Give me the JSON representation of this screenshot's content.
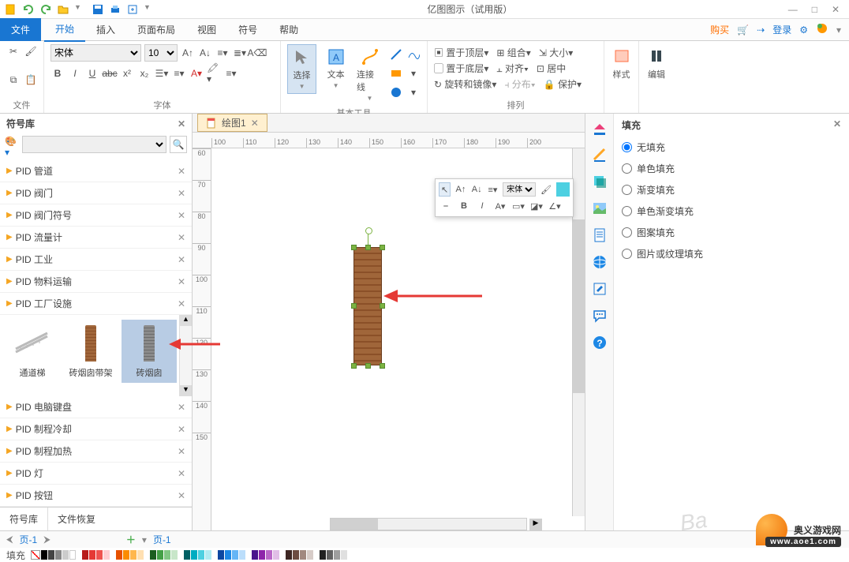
{
  "app": {
    "title": "亿图图示（试用版）"
  },
  "window_controls": {
    "min": "—",
    "max": "□",
    "close": "✕"
  },
  "menu": {
    "file": "文件",
    "items": [
      "开始",
      "插入",
      "页面布局",
      "视图",
      "符号",
      "帮助"
    ],
    "right": {
      "buy": "购买",
      "login": "登录"
    }
  },
  "ribbon": {
    "group_file": "文件",
    "group_font": "字体",
    "group_tools": "基本工具",
    "group_arrange": "排列",
    "group_style": "样式",
    "group_edit": "编辑",
    "font_name": "宋体",
    "font_size": "10",
    "bold": "B",
    "italic": "I",
    "underline": "U",
    "strike": "abc",
    "sup": "x²",
    "sub": "x₂",
    "tool_select": "选择",
    "tool_text": "文本",
    "tool_connector": "连接线",
    "arr_front": "置于顶层",
    "arr_back": "置于底层",
    "arr_rotate": "旋转和镜像",
    "arr_group": "组合",
    "arr_align": "对齐",
    "arr_distribute": "分布",
    "arr_size": "大小",
    "arr_center": "居中",
    "arr_protect": "保护",
    "style": "样式",
    "edit": "编辑"
  },
  "sidebar": {
    "title": "符号库",
    "search_placeholder": "",
    "categories": [
      "PID 管道",
      "PID 阀门",
      "PID 阀门符号",
      "PID 流量计",
      "PID 工业",
      "PID 物料运输",
      "PID 工厂设施"
    ],
    "categories_after": [
      "PID 电脑键盘",
      "PID 制程冷却",
      "PID 制程加热",
      "PID 灯",
      "PID 按钮"
    ],
    "shapes": [
      "通道梯",
      "砖烟囱带架",
      "砖烟囱"
    ],
    "footer": {
      "lib": "符号库",
      "recover": "文件恢复"
    }
  },
  "tabs": {
    "main": "绘图1"
  },
  "ruler_h": [
    "100",
    "110",
    "120",
    "130",
    "140",
    "150",
    "160",
    "170",
    "180",
    "190",
    "200"
  ],
  "ruler_v": [
    "60",
    "70",
    "80",
    "90",
    "100",
    "110",
    "120",
    "130",
    "140",
    "150"
  ],
  "float_tb": {
    "font_opt": "宋体"
  },
  "fill_panel": {
    "title": "填充",
    "options": [
      "无填充",
      "单色填充",
      "渐变填充",
      "单色渐变填充",
      "图案填充",
      "图片或纹理填充"
    ]
  },
  "page_bar": {
    "left": "页-1",
    "right": "页-1",
    "fill_label": "填充"
  },
  "watermark": {
    "text": "奥义游戏网",
    "url": "www.aoe1.com",
    "baidu": "Ba"
  }
}
